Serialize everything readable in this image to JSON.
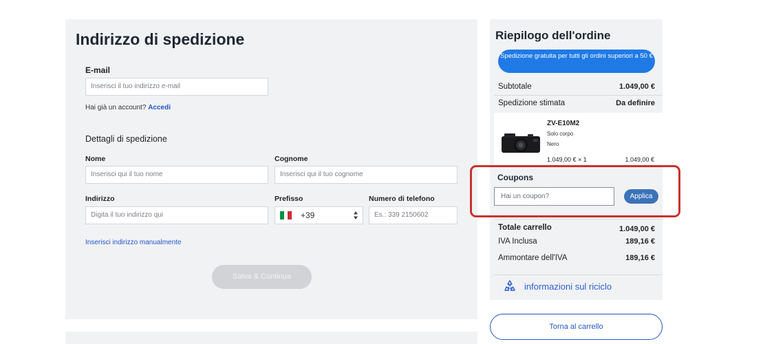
{
  "shipping": {
    "title": "Indirizzo di spedizione",
    "email_label": "E-mail",
    "email_placeholder": "Inserisci il tuo indirizzo e-mail",
    "account_prompt": "Hai già un account?",
    "login_link": "Accedi",
    "details_title": "Dettagli di spedizione",
    "first_name_label": "Nome",
    "first_name_placeholder": "Inserisci qui il tuo nome",
    "last_name_label": "Cognome",
    "last_name_placeholder": "Inserisci qui il tuo cognome",
    "address_label": "Indirizzo",
    "address_placeholder": "Digita il tuo indirizzo qui",
    "prefix_label": "Prefisso",
    "prefix_value": "+39",
    "prefix_flag_colors": [
      "#009246",
      "#ffffff",
      "#ce2b37"
    ],
    "phone_label": "Numero di telefono",
    "phone_placeholder": "Es.: 339 2150602",
    "manual_address_link": "Inserisci indirizzo manualmente",
    "save_button": "Salva & Continua"
  },
  "summary": {
    "title": "Riepilogo dell'ordine",
    "promo_text": "Spedizione gratuita per tutti gli ordini superiori a 50 €",
    "subtotal_label": "Subtotale",
    "subtotal_value": "1.049,00 €",
    "shipping_label": "Spedizione stimata",
    "shipping_value": "Da definire",
    "product": {
      "name": "ZV-E10M2",
      "variant": "Solo corpo",
      "color": "Nero",
      "unit_price_qty": "1.049,00 € × 1",
      "line_total": "1.049,00 €",
      "image_icon": "camera-icon"
    },
    "coupons_title": "Coupons",
    "coupon_placeholder": "Hai un coupon?",
    "coupon_apply": "Applica",
    "cart_total_label": "Totale carrello",
    "cart_total_value": "1.049,00 €",
    "vat_included_label": "IVA Inclusa",
    "vat_included_value": "189,16 €",
    "vat_amount_label": "Ammontare dell'IVA",
    "vat_amount_value": "189,16 €",
    "recycle_text": "informazioni sul riciclo",
    "back_to_cart": "Torna al carrello"
  },
  "colors": {
    "accent_blue": "#2456c7",
    "promo_blue": "#1f7ae6",
    "highlight_red": "#c8332d"
  }
}
